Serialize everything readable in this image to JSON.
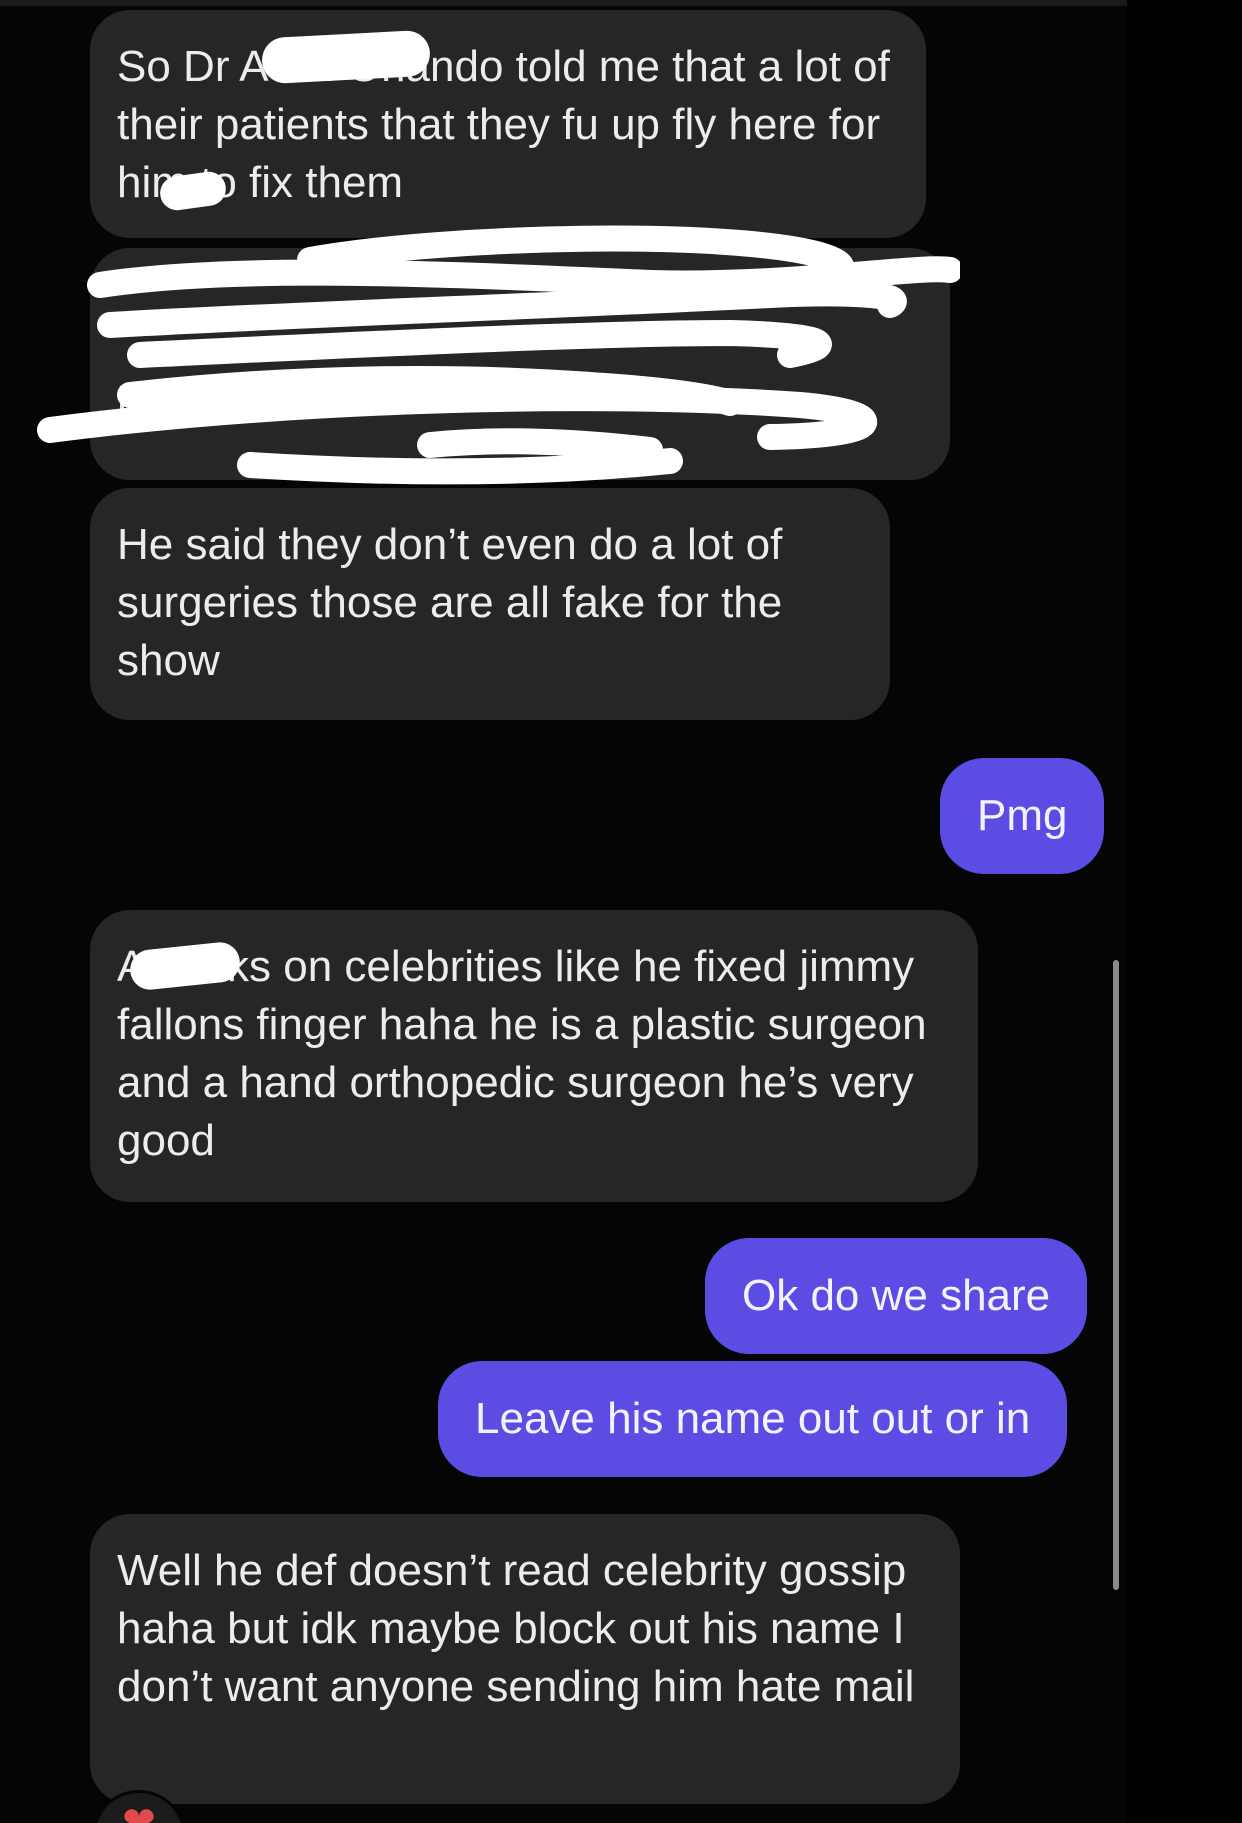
{
  "thread": {
    "messages": [
      {
        "from": "them",
        "text": "So Dr A       l in Orlando told me that a lot of their patients that they fu   up fly here for him to fix them"
      },
      {
        "from": "them",
        "text": "m          ter of      "
      },
      {
        "from": "them",
        "text": "He said they don’t even do a lot of surgeries those are all fake for the show"
      },
      {
        "from": "me",
        "text": "Pmg"
      },
      {
        "from": "them",
        "text": "A      works on celebrities like he fixed jimmy fallons finger haha he is a plastic surgeon and a hand orthopedic surgeon he’s very good"
      },
      {
        "from": "me",
        "text": "Ok do we share"
      },
      {
        "from": "me",
        "text": "Leave his name out out or in"
      },
      {
        "from": "them",
        "text": "Well he def doesn’t read celebrity gossip haha but idk maybe block out his name I don’t want anyone sending him hate mail"
      }
    ],
    "reaction_icon": "heart-icon",
    "reaction_glyph": "❤"
  },
  "colors": {
    "incoming_bubble": "#262626",
    "outgoing_bubble": "#5b4de4",
    "background": "#050505",
    "redaction": "#ffffff"
  }
}
